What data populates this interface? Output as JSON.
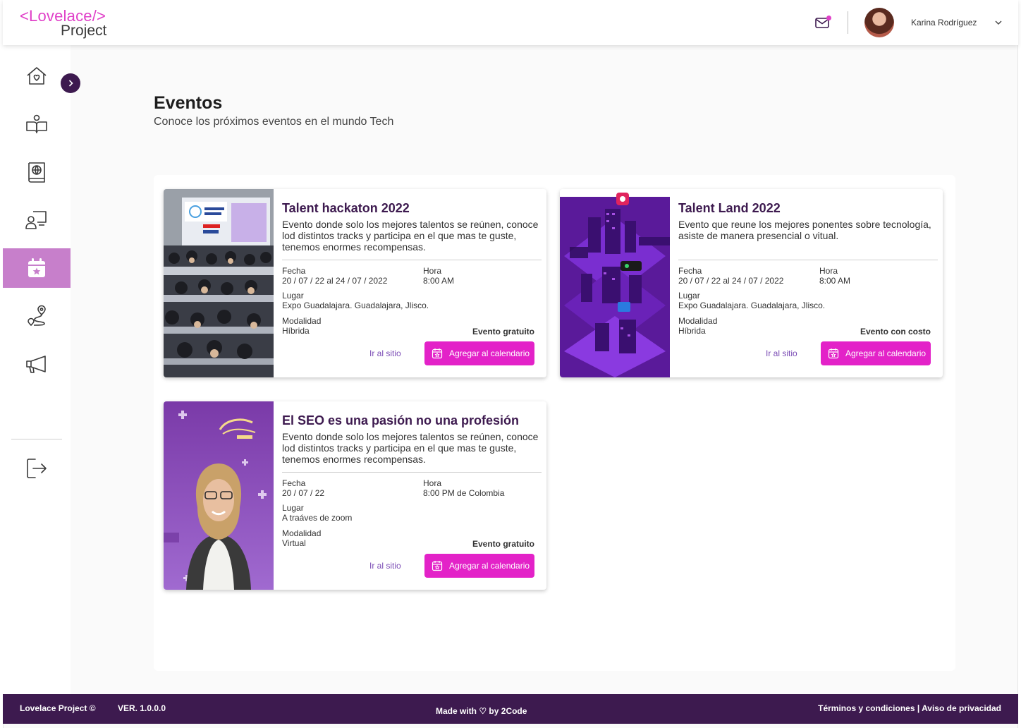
{
  "brand": {
    "logo_line1": "<Lovelace/>",
    "logo_line2": "Project"
  },
  "header": {
    "user_name": "Karina Rodríguez",
    "icons": [
      "mail-icon",
      "chevron-down-icon"
    ]
  },
  "sidebar": {
    "items": [
      {
        "id": "home",
        "icon": "home-heart-icon"
      },
      {
        "id": "courses",
        "icon": "open-book-icon"
      },
      {
        "id": "resources",
        "icon": "globe-book-icon"
      },
      {
        "id": "mentoring",
        "icon": "mentor-board-icon"
      },
      {
        "id": "events",
        "icon": "calendar-star-icon",
        "active": true
      },
      {
        "id": "route",
        "icon": "route-pin-icon"
      },
      {
        "id": "announcements",
        "icon": "megaphone-icon"
      }
    ],
    "logout_icon": "logout-icon"
  },
  "page": {
    "title": "Eventos",
    "subtitle": "Conoce los próximos eventos en el mundo Tech"
  },
  "labels": {
    "date": "Fecha",
    "time": "Hora",
    "place": "Lugar",
    "mode": "Modalidad",
    "site_link": "Ir al sitio",
    "calendar_button": "Agregar al calendario"
  },
  "events": [
    {
      "title": "Talent hackaton 2022",
      "description": "Evento donde solo los mejores talentos se reúnen, conoce lod distintos tracks y participa en el que mas te guste, tenemos enormes recompensas.",
      "date": "20 / 07 / 22  al  24 / 07 / 2022",
      "time": "8:00 AM",
      "place": "Expo Guadalajara. Guadalajara, Jlisco.",
      "mode": "Híbrida",
      "cost": "Evento gratuito"
    },
    {
      "title": "Talent Land 2022",
      "description": "Evento que reune los mejores ponentes sobre tecnología, asiste de manera presencial o vitual.",
      "date": "20 / 07 / 22  al  24 / 07 / 2022",
      "time": "8:00 AM",
      "place": "Expo Guadalajara. Guadalajara, Jlisco.",
      "mode": "Híbrida",
      "cost": "Evento con costo"
    },
    {
      "title": "El SEO es una pasión no una profesión",
      "description": "Evento donde solo los mejores talentos se reúnen, conoce lod distintos tracks y participa en el que mas te guste, tenemos enormes recompensas.",
      "date": "20 / 07 / 22",
      "time": "8:00 PM de Colombia",
      "place": "A traáves de zoom",
      "mode": "Virtual",
      "cost": "Evento gratuito"
    }
  ],
  "footer": {
    "copyright": "Lovelace Project ©",
    "version": "VER. 1.0.0.0",
    "made_with": "Made with ♡ by 2Code",
    "legal": "Términos y condiciones | Aviso de privacidad"
  },
  "colors": {
    "brand_purple": "#3d1a4f",
    "accent_pink": "#e322c8",
    "active_nav": "#c77fcb",
    "link": "#7a4bb5"
  }
}
